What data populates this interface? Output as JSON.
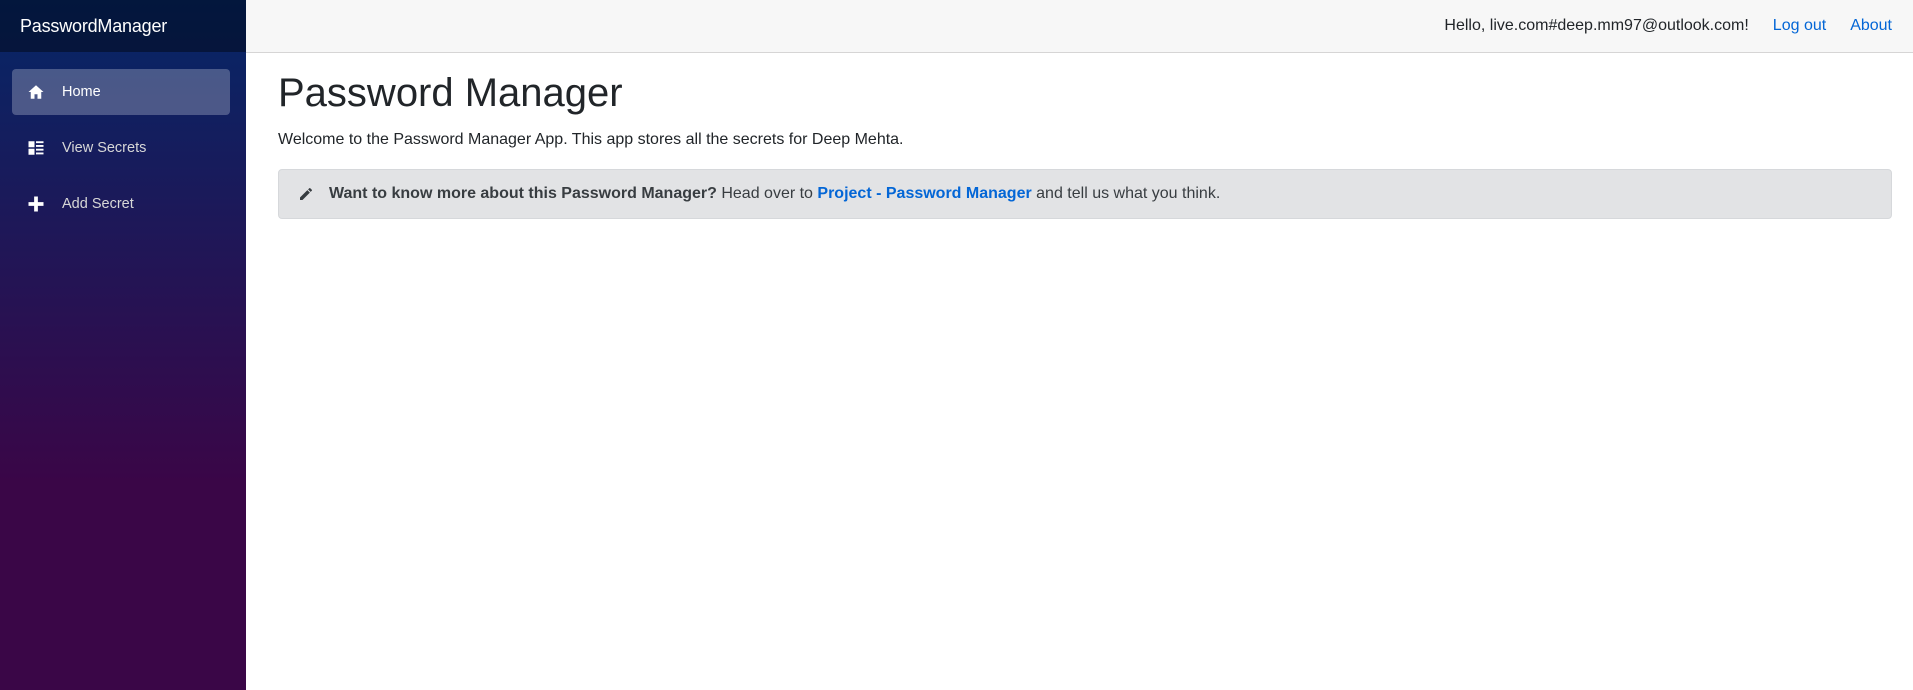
{
  "brand": {
    "name": "PasswordManager"
  },
  "sidebar": {
    "items": [
      {
        "label": "Home",
        "icon": "home-icon",
        "active": true
      },
      {
        "label": "View Secrets",
        "icon": "list-icon",
        "active": false
      },
      {
        "label": "Add Secret",
        "icon": "plus-icon",
        "active": false
      }
    ]
  },
  "header": {
    "greeting": "Hello, live.com#deep.mm97@outlook.com!",
    "logout_label": "Log out",
    "about_label": "About"
  },
  "main": {
    "title": "Password Manager",
    "welcome": "Welcome to the Password Manager App. This app stores all the secrets for Deep Mehta.",
    "alert": {
      "icon": "pencil-icon",
      "question": "Want to know more about this Password Manager?",
      "lead": "Head over to",
      "link_text": "Project - Password Manager",
      "tail": "and tell us what you think."
    }
  },
  "colors": {
    "sidebar_gradient_top": "#052767",
    "sidebar_gradient_bottom": "#3a0647",
    "link": "#0366d6",
    "alert_bg": "#e2e3e5"
  }
}
